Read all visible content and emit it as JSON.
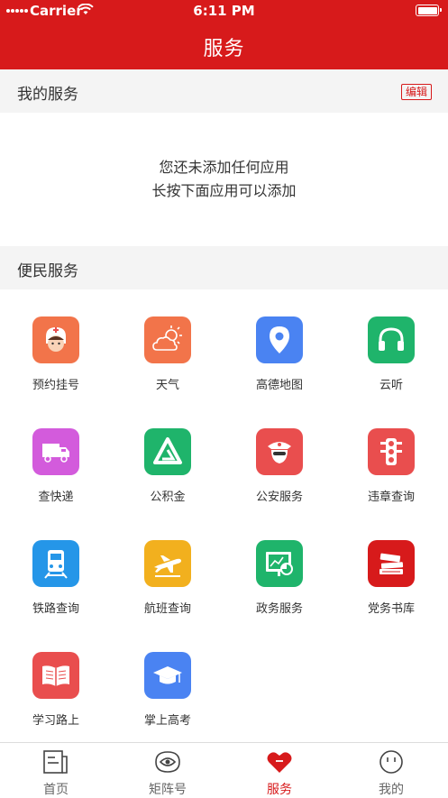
{
  "status_bar": {
    "carrier": "Carrier",
    "time": "6:11 PM"
  },
  "header": {
    "title": "服务"
  },
  "my_services": {
    "heading": "我的服务",
    "edit_label": "编辑",
    "empty_line1": "您还未添加任何应用",
    "empty_line2": "长按下面应用可以添加"
  },
  "convenience": {
    "heading": "便民服务",
    "items": [
      {
        "label": "预约挂号",
        "icon": "nurse-icon",
        "color": "#f2744a"
      },
      {
        "label": "天气",
        "icon": "weather-icon",
        "color": "#f2744a"
      },
      {
        "label": "高德地图",
        "icon": "map-pin-icon",
        "color": "#4a83f2"
      },
      {
        "label": "云听",
        "icon": "headphones-icon",
        "color": "#1fb46b"
      },
      {
        "label": "查快递",
        "icon": "delivery-truck-icon",
        "color": "#d35bdc"
      },
      {
        "label": "公积金",
        "icon": "housing-fund-icon",
        "color": "#1fb46b"
      },
      {
        "label": "公安服务",
        "icon": "police-icon",
        "color": "#e94e4e"
      },
      {
        "label": "违章查询",
        "icon": "traffic-light-icon",
        "color": "#e94e4e"
      },
      {
        "label": "铁路查询",
        "icon": "train-icon",
        "color": "#2596e8"
      },
      {
        "label": "航班查询",
        "icon": "airplane-icon",
        "color": "#f2b01e"
      },
      {
        "label": "政务服务",
        "icon": "gov-chart-icon",
        "color": "#1fb46b"
      },
      {
        "label": "党务书库",
        "icon": "books-icon",
        "color": "#d71a1b"
      },
      {
        "label": "学习路上",
        "icon": "open-book-icon",
        "color": "#e94e4e"
      },
      {
        "label": "掌上高考",
        "icon": "graduation-cap-icon",
        "color": "#4a83f2"
      }
    ]
  },
  "tabbar": {
    "tabs": [
      {
        "label": "首页",
        "icon": "news-icon"
      },
      {
        "label": "矩阵号",
        "icon": "eye-icon"
      },
      {
        "label": "服务",
        "icon": "heart-icon",
        "active": true
      },
      {
        "label": "我的",
        "icon": "face-icon"
      }
    ]
  }
}
